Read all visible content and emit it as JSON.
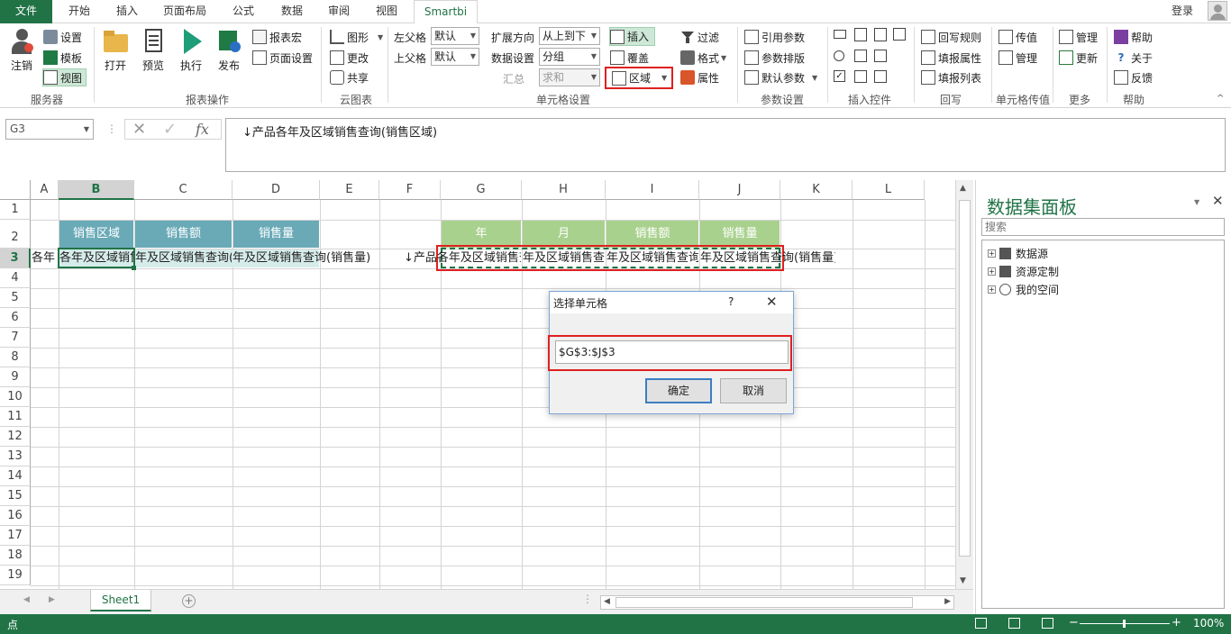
{
  "tabs": {
    "file": "文件",
    "home": "开始",
    "insert": "插入",
    "layout": "页面布局",
    "formulas": "公式",
    "data": "数据",
    "review": "审阅",
    "view": "视图",
    "smartbi": "Smartbi"
  },
  "login": "登录",
  "ribbon": {
    "server": {
      "login": "注销",
      "settings": "设置",
      "template": "模板",
      "view": "视图",
      "group": "服务器"
    },
    "report": {
      "open": "打开",
      "preview": "预览",
      "execute": "执行",
      "publish": "发布",
      "macro": "报表宏",
      "page_setup": "页面设置",
      "group": "报表操作"
    },
    "cloud": {
      "chart": "图形",
      "change": "更改",
      "share": "共享",
      "group": "云图表"
    },
    "cell": {
      "left_parent": "左父格",
      "left_parent_val": "默认",
      "top_parent": "上父格",
      "top_parent_val": "默认",
      "expand_dir": "扩展方向",
      "expand_dir_val": "从上到下",
      "data_setting": "数据设置",
      "data_setting_val": "分组",
      "summary": "汇总",
      "summary_val": "求和",
      "insert": "插入",
      "overlay": "覆盖",
      "region": "区域",
      "filter": "过滤",
      "format": "格式",
      "property": "属性",
      "group": "单元格设置"
    },
    "param": {
      "ref": "引用参数",
      "layout": "参数排版",
      "default": "默认参数",
      "group": "参数设置"
    },
    "controls": {
      "group": "插入控件"
    },
    "writeback": {
      "rule": "回写规则",
      "fill_prop": "填报属性",
      "fill_list": "填报列表",
      "group": "回写"
    },
    "cellval": {
      "pass": "传值",
      "manage": "管理",
      "group": "单元格传值"
    },
    "more": {
      "manage": "管理",
      "update": "更新",
      "group": "更多"
    },
    "help": {
      "help": "帮助",
      "about": "关于",
      "feedback": "反馈",
      "group": "帮助"
    }
  },
  "formula_bar": {
    "namebox": "G3",
    "fx": "fx",
    "formula": "↓产品各年及区域销售查询(销售区域)"
  },
  "columns": [
    "A",
    "B",
    "C",
    "D",
    "E",
    "F",
    "G",
    "H",
    "I",
    "J",
    "K",
    "L"
  ],
  "rows": [
    "1",
    "2",
    "3",
    "4",
    "5",
    "6",
    "7",
    "8",
    "9",
    "10",
    "11",
    "12",
    "13",
    "14",
    "15",
    "16",
    "17",
    "18",
    "19"
  ],
  "table1": {
    "headers": [
      "销售区域",
      "销售额",
      "销售量"
    ],
    "row3": [
      "各年及区域销售查询(",
      "年及区域销售查询(销",
      "年及区域销售查询(销售量)"
    ]
  },
  "table2": {
    "headers": [
      "年",
      "月",
      "销售额",
      "销售量"
    ],
    "row3": [
      "↓产品各年及区域销售查",
      "年及区域销售查询(",
      "年及区域销售查询(",
      "年及区域销售查询(销售量)"
    ]
  },
  "sheet": {
    "tab": "Sheet1"
  },
  "status": {
    "mode": "点",
    "zoom": "100%"
  },
  "panel": {
    "title": "数据集面板",
    "search_placeholder": "搜索",
    "tree": [
      "数据源",
      "资源定制",
      "我的空间"
    ]
  },
  "dialog": {
    "title": "选择单元格",
    "help": "?",
    "value": "$G$3:$J$3",
    "ok": "确定",
    "cancel": "取消"
  },
  "colors": {
    "excel_green": "#217346",
    "table1_header": "#6aaab7",
    "table1_row": "#d6ecea",
    "table2_header": "#a9d18e",
    "red": "#e02020"
  }
}
